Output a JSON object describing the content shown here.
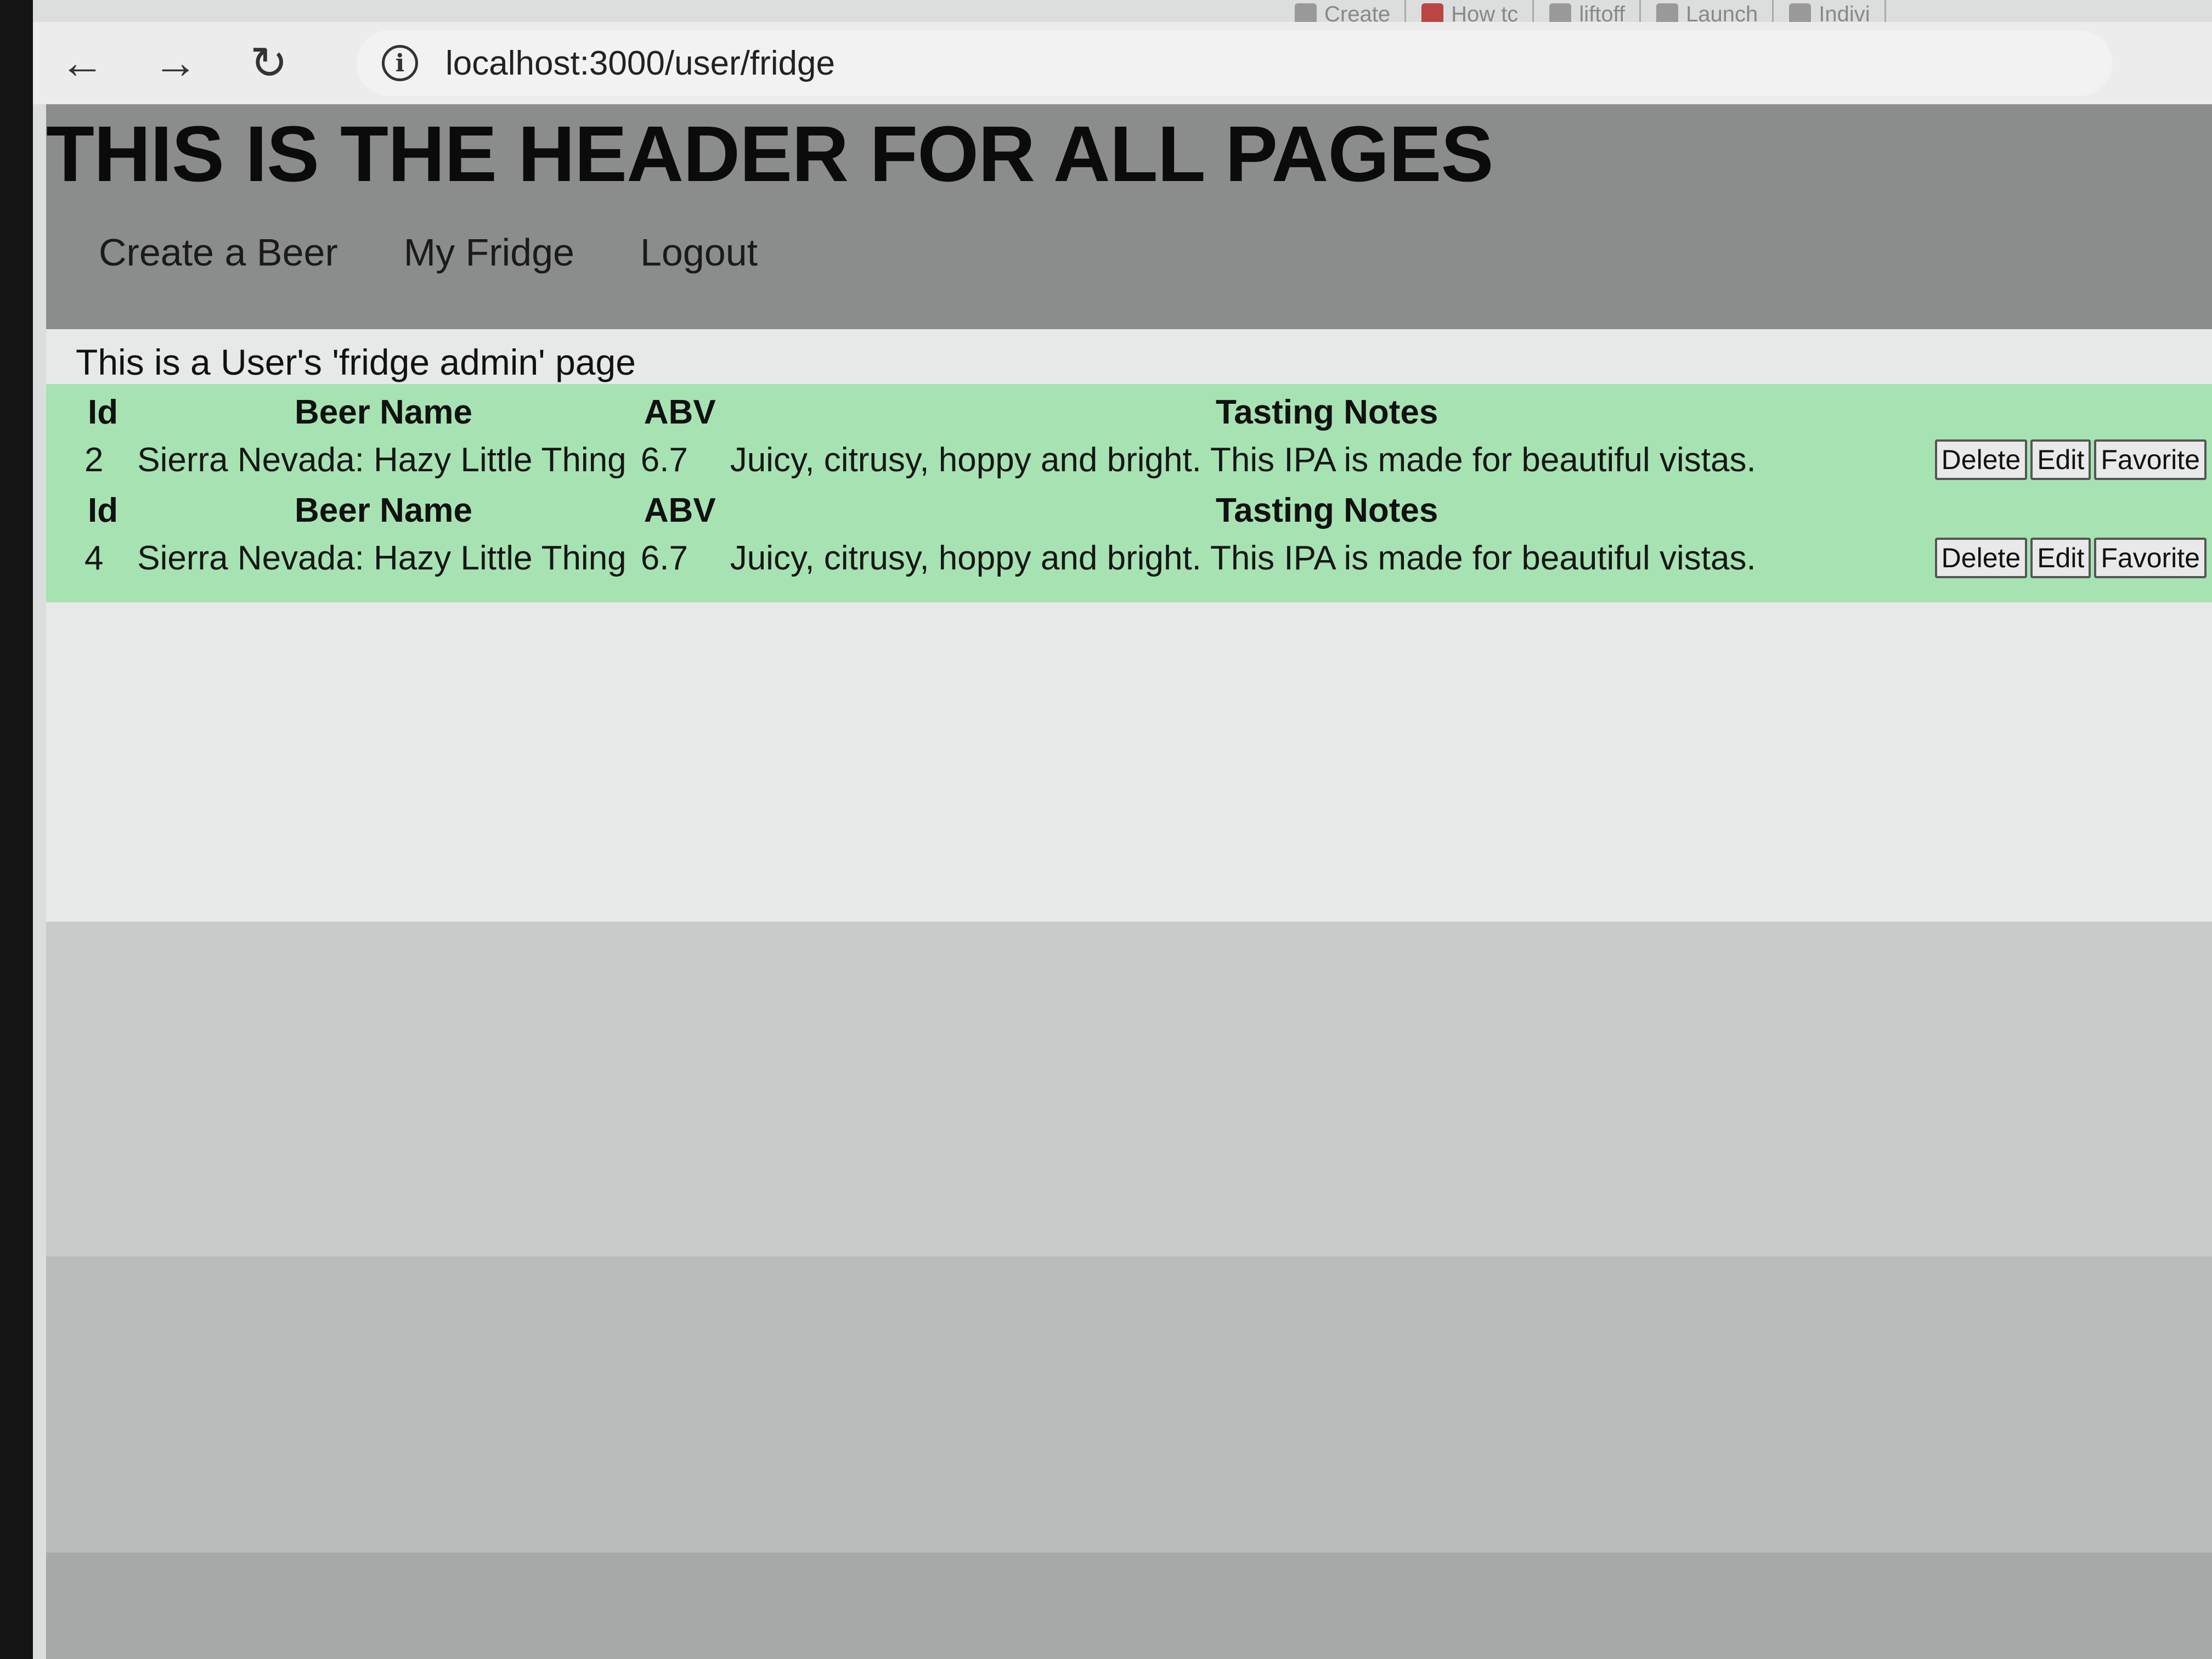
{
  "browser": {
    "bookmarks": [
      {
        "label": "Create",
        "icon": "globe-icon"
      },
      {
        "label": "How tc",
        "icon": "bookmark-icon"
      },
      {
        "label": "liftoff",
        "icon": "bookmark-icon"
      },
      {
        "label": "Launch",
        "icon": "document-icon"
      },
      {
        "label": "Indivi",
        "icon": "bookmark-icon"
      }
    ],
    "url": "localhost:3000/user/fridge"
  },
  "header": {
    "title": "THIS IS THE HEADER FOR ALL PAGES",
    "nav": [
      {
        "label": "Create a Beer"
      },
      {
        "label": "My Fridge"
      },
      {
        "label": "Logout"
      }
    ]
  },
  "page": {
    "subtitle": "This is a User's 'fridge admin' page",
    "columns": {
      "id": "Id",
      "name": "Beer Name",
      "abv": "ABV",
      "notes": "Tasting Notes"
    },
    "buttons": {
      "delete": "Delete",
      "edit": "Edit",
      "favorite": "Favorite"
    },
    "beers": [
      {
        "id": "2",
        "name": "Sierra Nevada: Hazy Little Thing",
        "abv": "6.7",
        "notes": "Juicy, citrusy, hoppy and bright. This IPA is made for beautiful vistas."
      },
      {
        "id": "4",
        "name": "Sierra Nevada: Hazy Little Thing",
        "abv": "6.7",
        "notes": "Juicy, citrusy, hoppy and bright. This IPA is made for beautiful vistas."
      }
    ]
  },
  "colors": {
    "header_bg": "#8b8d8c",
    "table_bg": "#a7e3b2"
  }
}
